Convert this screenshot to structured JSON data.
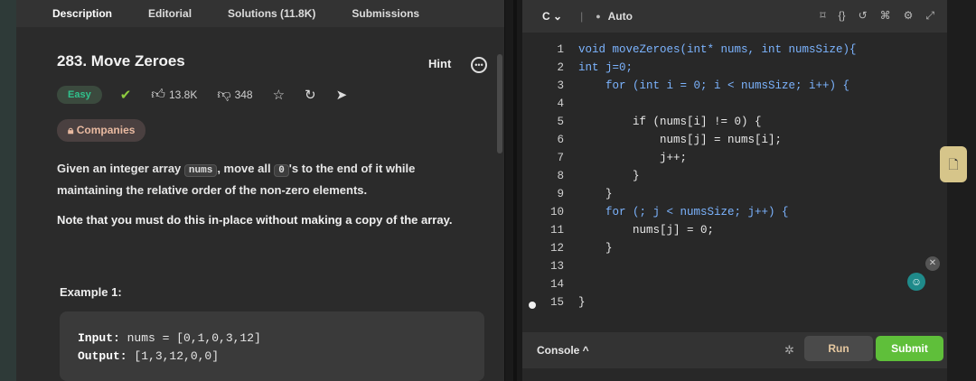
{
  "tabs": [
    "Description",
    "Editorial",
    "Solutions (11.8K)",
    "Submissions"
  ],
  "problem": {
    "title": "283. Move Zeroes",
    "hint_label": "Hint",
    "difficulty": "Easy",
    "likes": "13.8K",
    "dislikes": "348",
    "companies_label": "Companies",
    "desc_part1": "Given an integer array ",
    "desc_code1": "nums",
    "desc_part2": ", move all ",
    "desc_code2": "0",
    "desc_part3": "'s to the end of it while maintaining the relative order of the non-zero elements.",
    "note": "Note that you must do this in-place without making a copy of the array.",
    "example_title": "Example 1:",
    "example_input_label": "Input:",
    "example_input_value": " nums = [0,1,0,3,12]",
    "example_output_label": "Output:",
    "example_output_value": " [1,3,12,0,0]"
  },
  "editor": {
    "language": "C",
    "auto_label": "Auto",
    "lines": [
      {
        "n": "1",
        "code": "void moveZeroes(int* nums, int numsSize){"
      },
      {
        "n": "2",
        "code": "int j=0;"
      },
      {
        "n": "3",
        "code": "    for (int i = 0; i < numsSize; i++) {"
      },
      {
        "n": "4",
        "code": ""
      },
      {
        "n": "5",
        "code": "        if (nums[i] != 0) {"
      },
      {
        "n": "6",
        "code": "            nums[j] = nums[i];"
      },
      {
        "n": "7",
        "code": "            j++;"
      },
      {
        "n": "8",
        "code": "        }"
      },
      {
        "n": "9",
        "code": "    }"
      },
      {
        "n": "10",
        "code": "    for (; j < numsSize; j++) {"
      },
      {
        "n": "11",
        "code": "        nums[j] = 0;"
      },
      {
        "n": "12",
        "code": "    }"
      },
      {
        "n": "13",
        "code": ""
      },
      {
        "n": "14",
        "code": ""
      },
      {
        "n": "15",
        "code": "}"
      }
    ]
  },
  "console": {
    "label": "Console ^",
    "run_label": "Run",
    "submit_label": "Submit"
  },
  "colors": {
    "easy": "#30c28d",
    "submit": "#5fbf3a",
    "keyword": "#7cb4ff"
  }
}
